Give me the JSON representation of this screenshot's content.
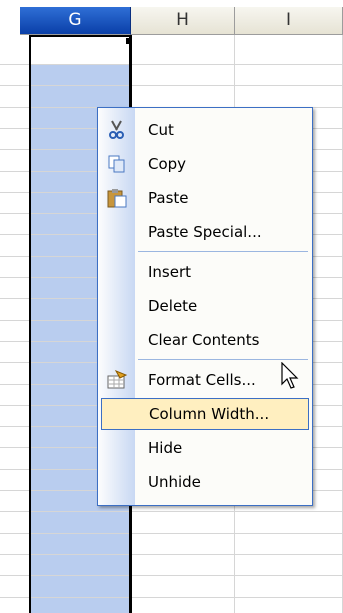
{
  "spreadsheet": {
    "columns": [
      {
        "label": "G",
        "selected": true
      },
      {
        "label": "H",
        "selected": false
      },
      {
        "label": "I",
        "selected": false
      }
    ],
    "selection_color": "#b9cdef",
    "header_selected_color": "#1b56c2"
  },
  "context_menu": {
    "items": [
      {
        "label": "Cut",
        "icon": "scissors-icon"
      },
      {
        "label": "Copy",
        "icon": "copy-icon"
      },
      {
        "label": "Paste",
        "icon": "clipboard-paste-icon"
      },
      {
        "label": "Paste Special...",
        "icon": ""
      },
      {
        "label": "Insert",
        "icon": ""
      },
      {
        "label": "Delete",
        "icon": ""
      },
      {
        "label": "Clear Contents",
        "icon": ""
      },
      {
        "label": "Format Cells...",
        "icon": "format-cells-icon"
      },
      {
        "label": "Column Width...",
        "icon": "",
        "highlighted": true
      },
      {
        "label": "Hide",
        "icon": ""
      },
      {
        "label": "Unhide",
        "icon": ""
      }
    ]
  }
}
